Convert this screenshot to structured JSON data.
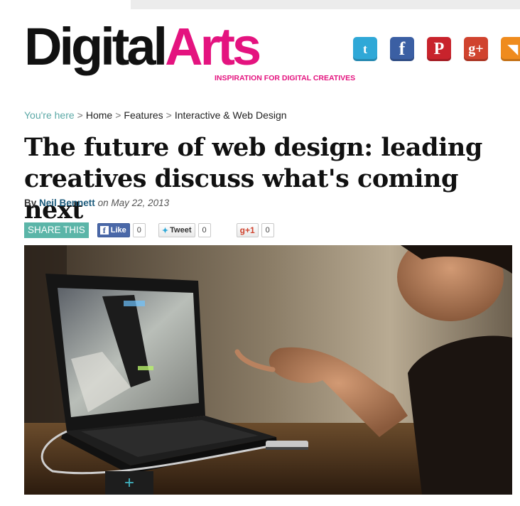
{
  "header": {
    "logo_part1": "Digital",
    "logo_part2": "Arts",
    "tagline": "INSPIRATION FOR DIGITAL CREATIVES"
  },
  "social": [
    {
      "name": "twitter-icon",
      "glyph": "t"
    },
    {
      "name": "facebook-icon",
      "glyph": "f"
    },
    {
      "name": "pinterest-icon",
      "glyph": "P"
    },
    {
      "name": "google-plus-icon",
      "glyph": "g+"
    },
    {
      "name": "rss-icon",
      "glyph": "◥"
    }
  ],
  "breadcrumb": {
    "prefix": "You're here",
    "items": [
      "Home",
      "Features",
      "Interactive & Web Design"
    ]
  },
  "article": {
    "title": "The future of web design: leading creatives discuss what's coming next",
    "by": "By",
    "author": "Neil Bennett",
    "on": "on",
    "date": "May 22, 2013"
  },
  "share": {
    "label": "SHARE THIS",
    "facebook_label": "Like",
    "facebook_count": "0",
    "tweet_label": "Tweet",
    "tweet_count": "0",
    "gplus_label": "+1",
    "gplus_count": "0"
  },
  "hero": {
    "expand_glyph": "+"
  },
  "colors": {
    "brand_pink": "#e4137f",
    "teal": "#5bb5a8",
    "author_blue": "#1c5b7c"
  }
}
